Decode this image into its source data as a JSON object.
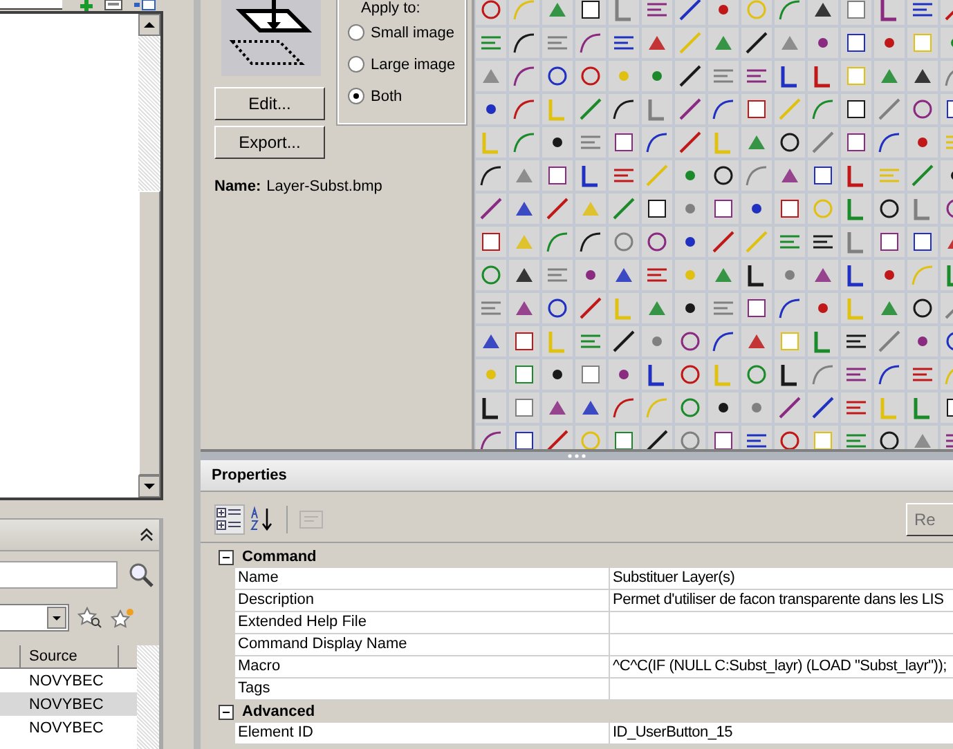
{
  "customizations_panel": {
    "tree_scrollbar": {
      "kind": "vertical"
    }
  },
  "command_list": {
    "table": {
      "columns": [
        "Source"
      ],
      "rows": [
        {
          "source": "NOVYBEC",
          "selected": false
        },
        {
          "source": "NOVYBEC",
          "selected": true
        },
        {
          "source": "NOVYBEC",
          "selected": false
        }
      ]
    }
  },
  "button_image": {
    "apply_to": {
      "title": "Apply to:",
      "options": [
        {
          "label": "Small image",
          "selected": false
        },
        {
          "label": "Large image",
          "selected": false
        },
        {
          "label": "Both",
          "selected": true
        }
      ]
    },
    "edit_button": "Edit...",
    "export_button": "Export...",
    "name_label": "Name:",
    "name_value": "Layer-Subst.bmp"
  },
  "properties": {
    "title": "Properties",
    "toolbar": [
      {
        "kind": "categorized",
        "selected": true,
        "disabled": false
      },
      {
        "kind": "alphabetical",
        "selected": false,
        "disabled": false
      },
      {
        "kind": "pages",
        "selected": false,
        "disabled": true
      }
    ],
    "reset_button": "Re",
    "categories": [
      {
        "name": "Command",
        "expanded": true,
        "rows": [
          {
            "name": "Name",
            "value": "Substituer Layer(s)"
          },
          {
            "name": "Description",
            "value": "Permet d'utiliser de facon transparente dans les LIS"
          },
          {
            "name": "Extended Help File",
            "value": ""
          },
          {
            "name": "Command Display Name",
            "value": ""
          },
          {
            "name": "Macro",
            "value": "^C^C(IF (NULL C:Subst_layr) (LOAD \"Subst_layr\"));"
          },
          {
            "name": "Tags",
            "value": ""
          }
        ]
      },
      {
        "name": "Advanced",
        "expanded": true,
        "rows": [
          {
            "name": "Element ID",
            "value": "ID_UserButton_15"
          }
        ]
      }
    ]
  }
}
